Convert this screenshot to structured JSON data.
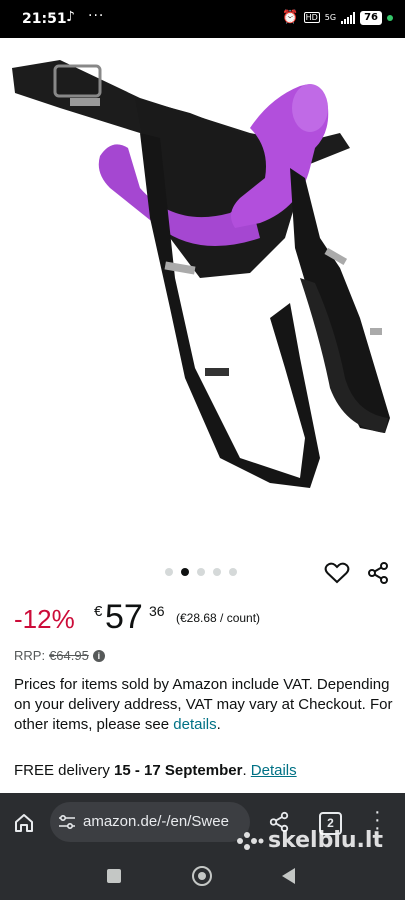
{
  "status_bar": {
    "time": "21:51",
    "battery": "76",
    "network": "5G",
    "icons": [
      "tiktok-icon",
      "more-dots-icon",
      "alarm-off-icon",
      "volte-icon",
      "signal-icon",
      "battery-icon"
    ]
  },
  "product": {
    "image_subject": "black harness with purple double-ended attachment",
    "carousel": {
      "total": 5,
      "active_index": 1
    },
    "discount": "-12%",
    "price_currency": "€",
    "price_whole": "57",
    "price_fraction": "36",
    "unit_price": "(€28.68 / count)",
    "rrp_label": "RRP:",
    "rrp_value": "€64.95",
    "vat_text": "Prices for items sold by Amazon include VAT. Depending on your delivery address, VAT may vary at Checkout. For other items, please see",
    "vat_link": "details",
    "vat_end": ".",
    "delivery_prefix": "FREE delivery",
    "delivery_dates": "15 - 17 September",
    "delivery_suffix": ".",
    "delivery_link": "Details"
  },
  "browser": {
    "url": "amazon.de/-/en/Swee",
    "tab_count": "2"
  },
  "watermark": "skelbiu.lt",
  "colors": {
    "discount": "#cc0c39",
    "link": "#007185",
    "browser_bg": "#2b2d30",
    "purple": "#b24fdc"
  }
}
